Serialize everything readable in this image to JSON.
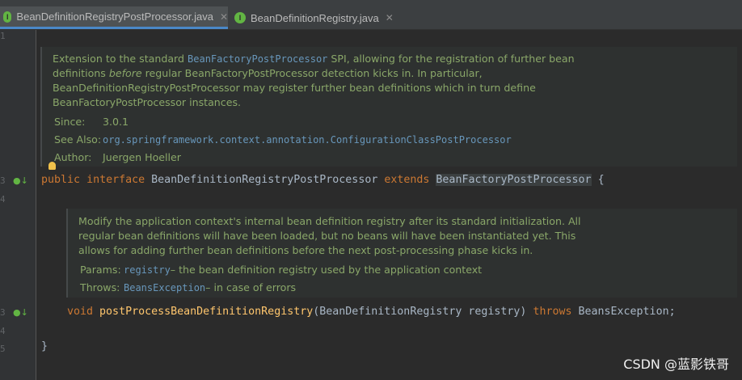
{
  "colors": {
    "background": "#2b2b2b",
    "keyword": "#cc7832",
    "method": "#ffc66d",
    "doc_text": "#8aa769",
    "link": "#6897bb"
  },
  "tabs": [
    {
      "label": "BeanDefinitionRegistryPostProcessor.java",
      "active": true,
      "icon": "interface-file-icon"
    },
    {
      "label": "BeanDefinitionRegistry.java",
      "active": false,
      "icon": "interface-file-icon"
    }
  ],
  "editor": {
    "line_numbers": [
      "1",
      "3",
      "4",
      "3",
      "4",
      "5"
    ],
    "doc1": {
      "p1_a": "Extension to the standard ",
      "p1_link": "BeanFactoryPostProcessor",
      "p1_b": " SPI, allowing for the registration of further bean",
      "p2_a": "definitions ",
      "p2_em": "before",
      "p2_b": " regular BeanFactoryPostProcessor detection kicks in. In particular,",
      "p3": "BeanDefinitionRegistryPostProcessor may register further bean definitions which in turn define",
      "p4": "BeanFactoryPostProcessor instances.",
      "since_label": "Since:",
      "since_value": "3.0.1",
      "see_label": "See Also:",
      "see_value": "org.springframework.context.annotation.ConfigurationClassPostProcessor",
      "author_label": "Author:",
      "author_value": "Juergen Hoeller"
    },
    "decl": {
      "kw_public": "public",
      "kw_interface": "interface",
      "name": "BeanDefinitionRegistryPostProcessor",
      "kw_extends": "extends",
      "parent": "BeanFactoryPostProcessor",
      "brace": "{"
    },
    "doc2": {
      "l1": "Modify the application context's internal bean definition registry after its standard initialization. All",
      "l2": "regular bean definitions will have been loaded, but no beans will have been instantiated yet. This",
      "l3": "allows for adding further bean definitions before the next post-processing phase kicks in.",
      "params_label": "Params:",
      "params_name": "registry",
      "params_desc": " – the bean definition registry used by the application context",
      "throws_label": "Throws:",
      "throws_name": "BeansException",
      "throws_desc": " – in case of errors"
    },
    "method": {
      "kw_void": "void",
      "name": "postProcessBeanDefinitionRegistry",
      "params": "(BeanDefinitionRegistry registry)",
      "kw_throws": "throws",
      "exception": "BeansException;"
    },
    "close_brace": "}"
  },
  "watermark": "CSDN @蓝影铁哥"
}
